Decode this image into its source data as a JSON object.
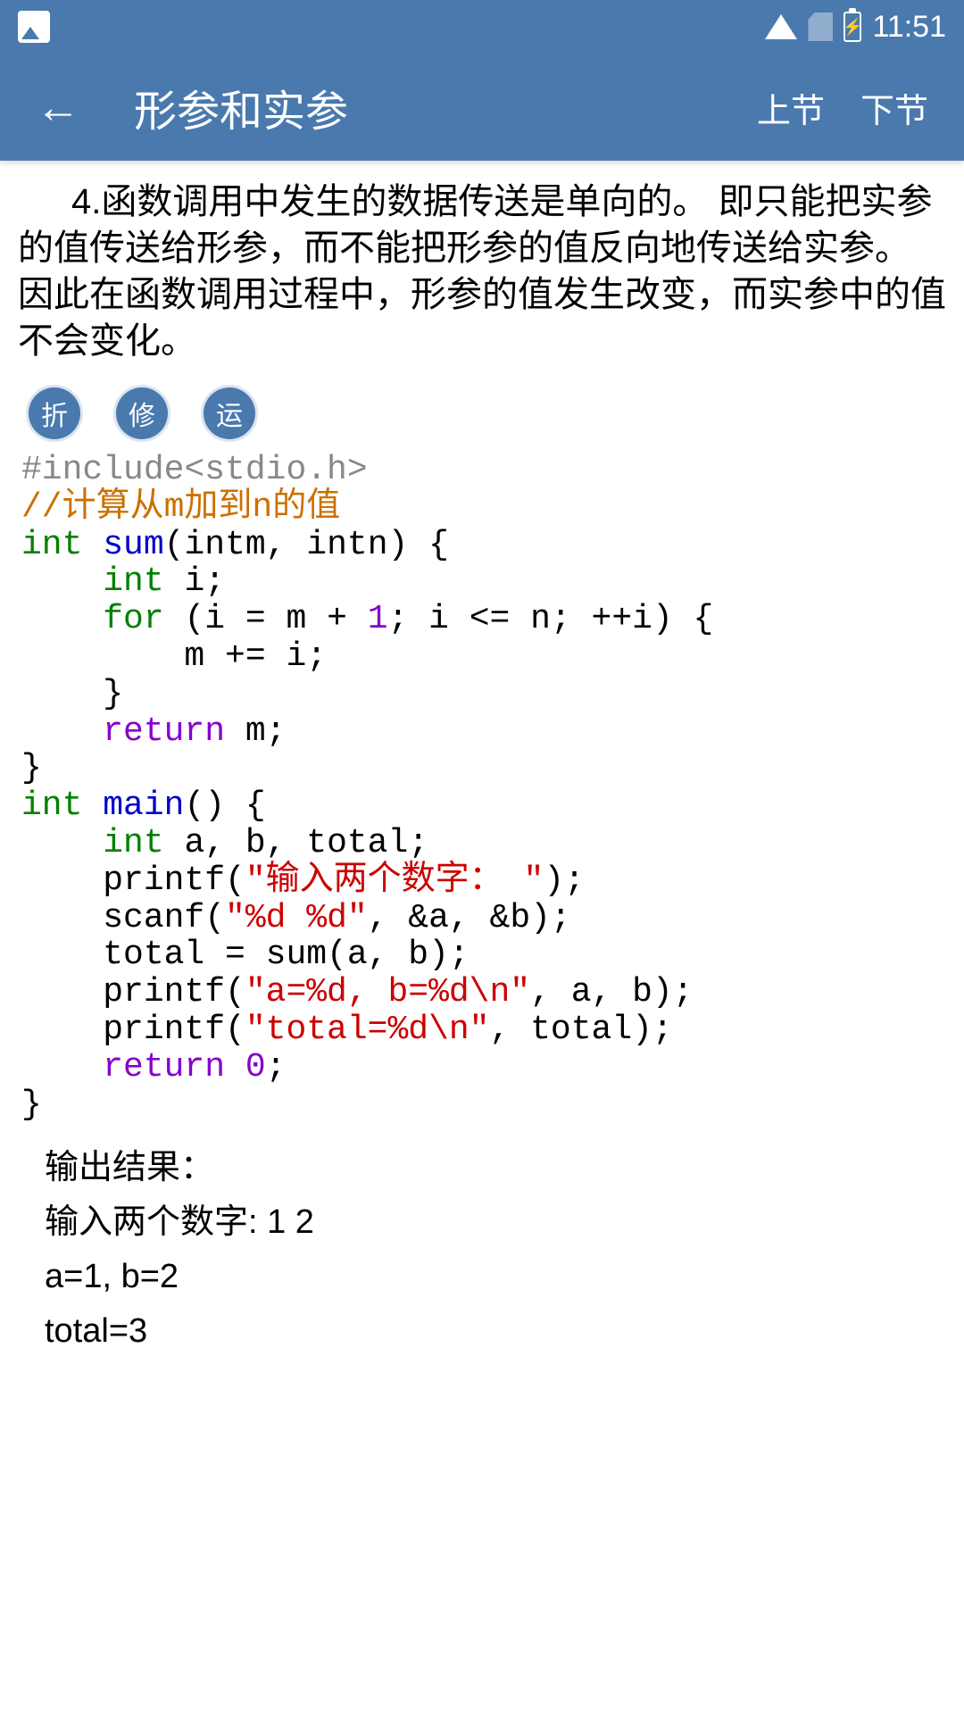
{
  "status": {
    "time": "11:51"
  },
  "header": {
    "title": "形参和实参",
    "prev": "上节",
    "next": "下节"
  },
  "content": {
    "paragraph": "4.函数调用中发生的数据传送是单向的。 即只能把实参的值传送给形参，而不能把形参的值反向地传送给实参。 因此在函数调用过程中，形参的值发生改变，而实参中的值不会变化。",
    "buttons": {
      "fold": "折",
      "edit": "修",
      "run": "运"
    },
    "code": {
      "include": "#include<stdio.h>",
      "comment": "//计算从m加到n的值",
      "l3_int": "int",
      "l3_sum": "sum",
      "l3_rest": "(intm, intn) {",
      "l4_int": "int",
      "l4_rest": " i;",
      "l5_for": "for",
      "l5_a": " (i = m + ",
      "l5_1": "1",
      "l5_b": "; i <= n; ++i) {",
      "l6": "        m += i;",
      "l7": "    }",
      "l8_ret": "return",
      "l8_rest": " m;",
      "l9": "}",
      "l10_int": "int",
      "l10_main": "main",
      "l10_rest": "() {",
      "l11_int": "int",
      "l11_rest": " a, b, total;",
      "l12_a": "    printf(",
      "l12_str": "\"输入两个数字： \"",
      "l12_b": ");",
      "l13_a": "    scanf(",
      "l13_str": "\"%d %d\"",
      "l13_b": ", &a, &b);",
      "l14": "    total = sum(a, b);",
      "l15_a": "    printf(",
      "l15_str": "\"a=%d, b=%d\\n\"",
      "l15_b": ", a, b);",
      "l16_a": "    printf(",
      "l16_str": "\"total=%d\\n\"",
      "l16_b": ", total);",
      "l17_ret": "return",
      "l17_sp": " ",
      "l17_0": "0",
      "l17_b": ";",
      "l18": "}"
    },
    "output": {
      "label": "输出结果：",
      "line1": "输入两个数字: 1 2",
      "line2": "a=1, b=2",
      "line3": "total=3"
    }
  }
}
